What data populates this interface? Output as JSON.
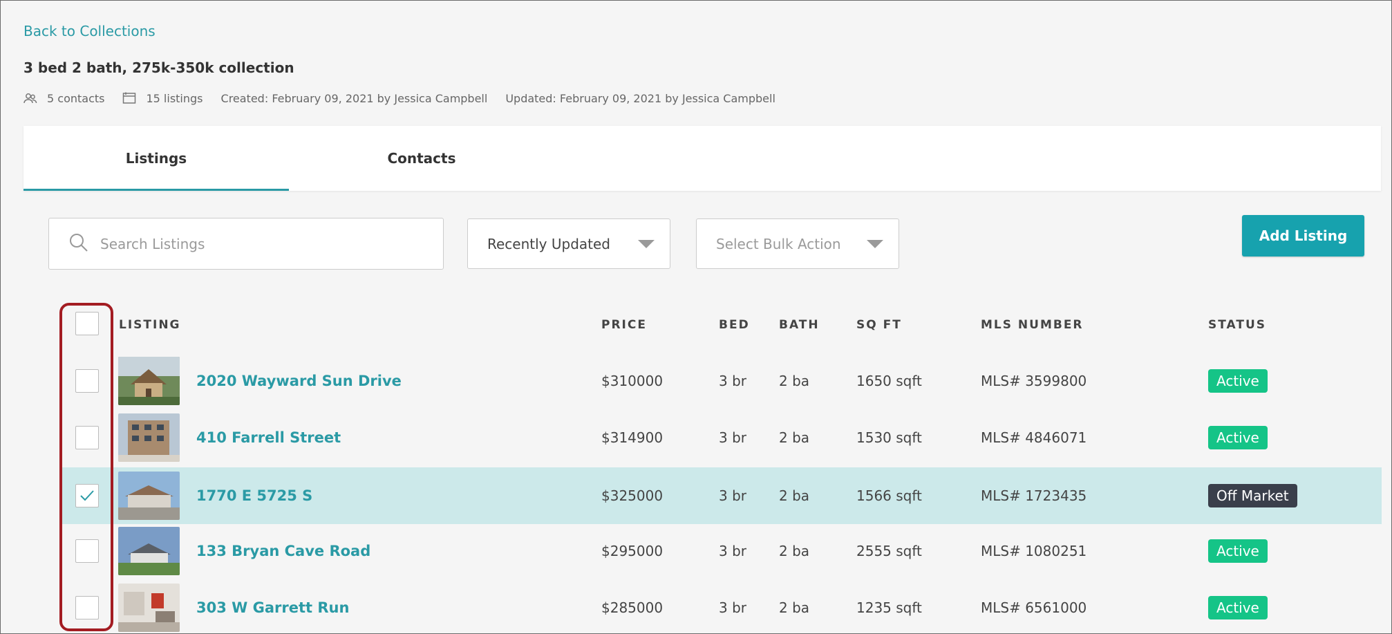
{
  "nav": {
    "back_label": "Back to Collections"
  },
  "page": {
    "title": "3 bed 2 bath, 275k-350k collection",
    "meta": {
      "contacts": "5 contacts",
      "listings": "15 listings",
      "created": "Created: February 09, 2021 by Jessica Campbell",
      "updated": "Updated: February 09, 2021 by Jessica Campbell"
    }
  },
  "tabs": [
    {
      "label": "Listings",
      "active": true
    },
    {
      "label": "Contacts",
      "active": false
    }
  ],
  "toolbar": {
    "search_placeholder": "Search Listings",
    "sort_value": "Recently Updated",
    "bulk_placeholder": "Select Bulk Action",
    "add_label": "Add Listing"
  },
  "table": {
    "headers": {
      "listing": "LISTING",
      "price": "PRICE",
      "bed": "BED",
      "bath": "BATH",
      "sqft": "SQ FT",
      "mls": "MLS NUMBER",
      "status": "STATUS"
    },
    "rows": [
      {
        "address": "2020 Wayward Sun Drive",
        "price": "$310000",
        "bed": "3 br",
        "bath": "2 ba",
        "sqft": "1650 sqft",
        "mls": "MLS# 3599800",
        "status": "Active",
        "checked": false
      },
      {
        "address": "410 Farrell Street",
        "price": "$314900",
        "bed": "3 br",
        "bath": "2 ba",
        "sqft": "1530 sqft",
        "mls": "MLS# 4846071",
        "status": "Active",
        "checked": false
      },
      {
        "address": "1770 E 5725 S",
        "price": "$325000",
        "bed": "3 br",
        "bath": "2 ba",
        "sqft": "1566 sqft",
        "mls": "MLS# 1723435",
        "status": "Off Market",
        "checked": true
      },
      {
        "address": "133 Bryan Cave Road",
        "price": "$295000",
        "bed": "3 br",
        "bath": "2 ba",
        "sqft": "2555 sqft",
        "mls": "MLS# 1080251",
        "status": "Active",
        "checked": false
      },
      {
        "address": "303 W Garrett Run",
        "price": "$285000",
        "bed": "3 br",
        "bath": "2 ba",
        "sqft": "1235 sqft",
        "mls": "MLS# 6561000",
        "status": "Active",
        "checked": false
      }
    ]
  },
  "colors": {
    "accent": "#17a2ae",
    "link": "#2a9aa5",
    "active_badge": "#15c487",
    "off_market_badge": "#3a3f4b",
    "selected_row": "#cce9ea",
    "annotation": "#a31c22"
  }
}
